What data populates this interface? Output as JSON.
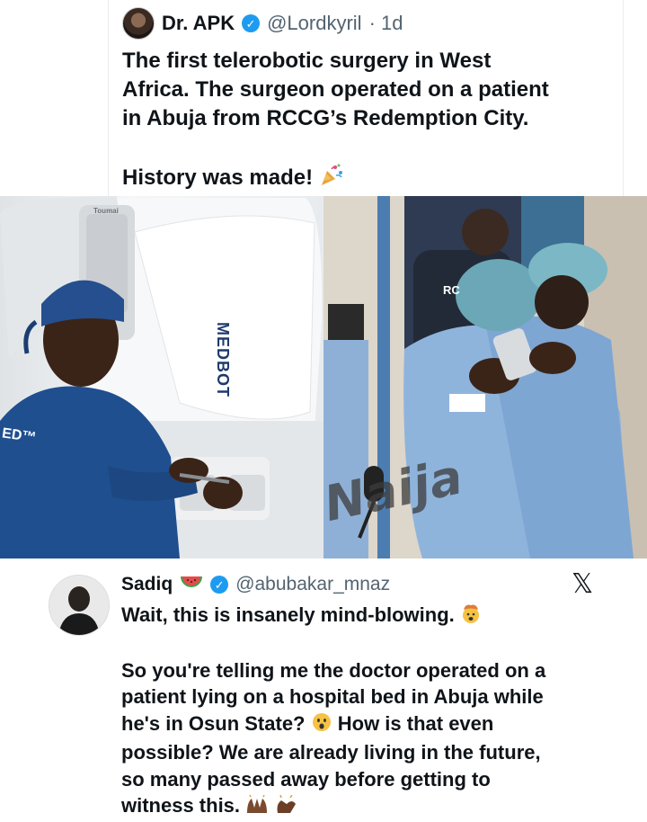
{
  "tweet": {
    "author_name": "Dr. APK",
    "verified_mark": "✓",
    "handle": "@Lordkyril",
    "time": "· 1d",
    "text_line1": "The first telerobotic surgery in West",
    "text_line2": "Africa. The surgeon operated on a patient",
    "text_line3": "in Abuja from RCCG’s Redemption City.",
    "text_line4": "History was made!",
    "emoji_icon": "party-popper-icon"
  },
  "photo": {
    "left": {
      "brand_label": "MEDBOT",
      "shirt_logo": "ED™",
      "top_label": "Toumai"
    },
    "right": {
      "sign_label": "RC"
    },
    "watermark": "Naija"
  },
  "reply": {
    "author_name": "Sadiq",
    "name_emoji": "watermelon-icon",
    "verified_mark": "✓",
    "handle": "@abubakar_mnaz",
    "x_logo": "𝕏",
    "line1": "Wait, this is insanely mind-blowing.",
    "line2": "So you're telling me the doctor operated on a",
    "line3": "patient lying on a hospital bed in Abuja while",
    "line4": "he's in Osun State?",
    "line4b": "How is that even",
    "line5": "possible? We are already living in the future,",
    "line6": "so many passed away before getting to",
    "line7": "witness this."
  },
  "colors": {
    "verified": "#1d9bf0",
    "scrubs": "#1f4f8f",
    "gown": "#8fb4dc",
    "cap": "#6ba7b6"
  }
}
